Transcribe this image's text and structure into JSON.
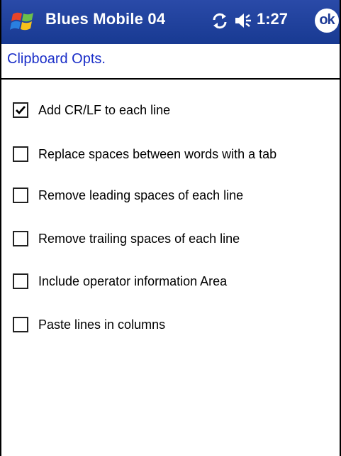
{
  "titlebar": {
    "app_title": "Blues Mobile 04",
    "clock": "1:27",
    "ok_label": "ok",
    "start_icon": "windows-flag-icon",
    "sync_icon": "sync-icon",
    "speaker_icon": "speaker-icon"
  },
  "page": {
    "title": "Clipboard Opts."
  },
  "options": [
    {
      "label": "Add CR/LF to each line",
      "checked": true
    },
    {
      "label": "Replace spaces between words with a tab",
      "checked": false
    },
    {
      "label": "Remove leading spaces of each line",
      "checked": false
    },
    {
      "label": "Remove trailing spaces of each line",
      "checked": false
    },
    {
      "label": "Include operator information Area",
      "checked": false
    },
    {
      "label": "Paste lines in columns",
      "checked": false
    }
  ],
  "colors": {
    "titlebar": "#1f3c96",
    "title_text": "#1a2ec8"
  }
}
